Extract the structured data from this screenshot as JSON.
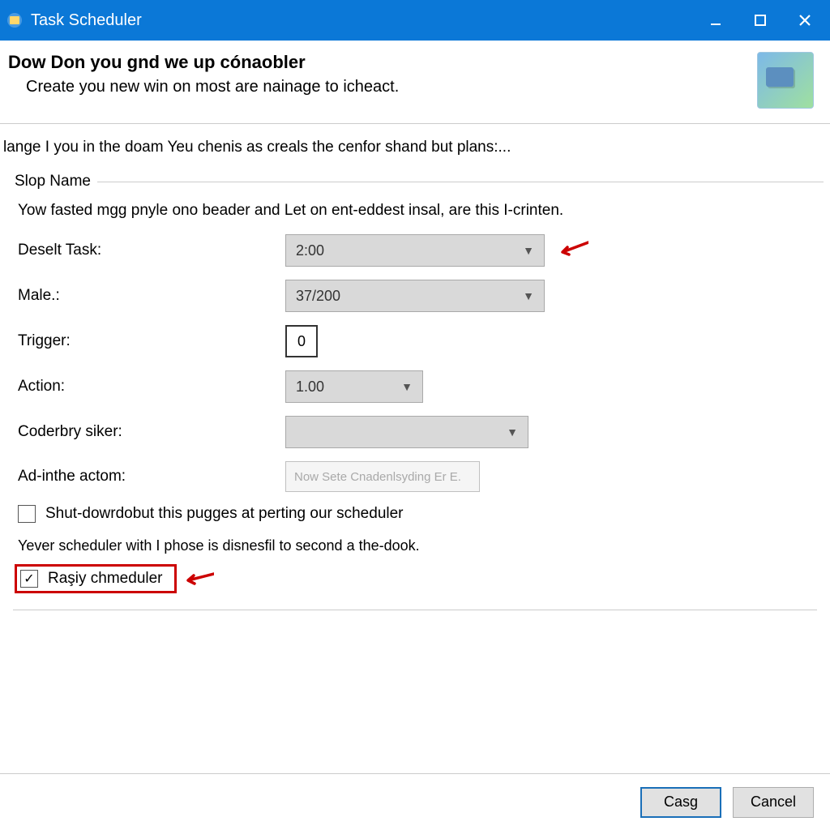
{
  "window": {
    "title": "Task Scheduler"
  },
  "header": {
    "title": "Dow Don you gnd we up cónaobler",
    "subtitle": "Create you new win on most are nainage to icheact."
  },
  "intro": "lange I you in the doam Yeu chenis as creals the cenfor shand but plans:...",
  "group": {
    "legend": "Slop Name",
    "desc": "Yow fasted mgg pnyle ono beader and Let on ent-eddest insal, are this I-crinten."
  },
  "fields": {
    "deselt_label": "Deselt Task:",
    "deselt_value": "2:00",
    "male_label": "Male.:",
    "male_value": "37/200",
    "trigger_label": "Trigger:",
    "trigger_value": "0",
    "action_label": "Action:",
    "action_value": "1.00",
    "coderbry_label": "Coderbry siker:",
    "coderbry_value": "",
    "adin_label": "Ad-inthe actom:",
    "adin_placeholder": "Now Sete Cnadenlsyding Er E."
  },
  "checks": {
    "shut_label": "Shut-dowrdobut this pugges at perting our scheduler",
    "shut_checked": false,
    "note": "Yever scheduler with I phose is disnesfil to second a the-dook.",
    "rasy_label": "Raşiy chmeduler",
    "rasy_checked": true
  },
  "buttons": {
    "ok": "Casg",
    "cancel": "Cancel"
  }
}
